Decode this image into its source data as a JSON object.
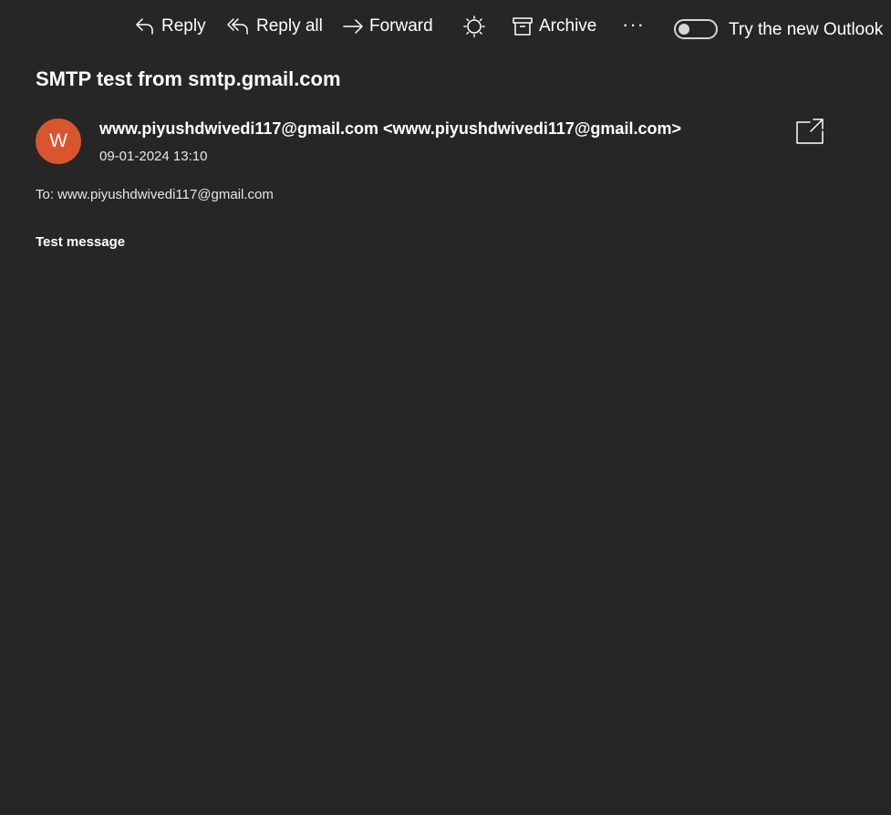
{
  "toolbar": {
    "reply_label": "Reply",
    "reply_all_label": "Reply all",
    "forward_label": "Forward",
    "archive_label": "Archive",
    "more_label": "···",
    "new_outlook_label": "Try the new Outlook",
    "new_outlook_enabled": false,
    "icons": [
      "reply-icon",
      "reply-all-icon",
      "forward-icon",
      "sweep-icon",
      "archive-icon",
      "more-icon"
    ]
  },
  "message": {
    "subject": "SMTP test from smtp.gmail.com",
    "avatar_initial": "W",
    "avatar_color": "#d9552e",
    "sender": "www.piyushdwivedi117@gmail.com <www.piyushdwivedi117@gmail.com>",
    "date": "09-01-2024 13:10",
    "to": "To: www.piyushdwivedi117@gmail.com",
    "body": "Test message"
  },
  "colors": {
    "background": "#262626",
    "text": "#ffffff"
  }
}
